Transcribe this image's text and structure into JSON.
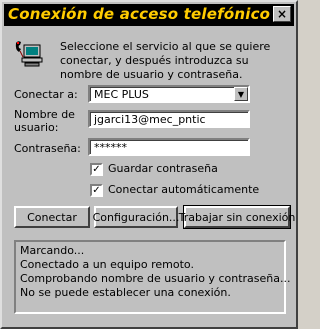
{
  "window": {
    "title": "Conexión de acceso telefónico",
    "close_glyph": "×"
  },
  "intro_text": "Seleccione el servicio al que se quiere conectar, y después introduzca su nombre de usuario y contraseña.",
  "form": {
    "connect_to": {
      "label": "Conectar a:",
      "value": "MEC PLUS",
      "arrow": "▼"
    },
    "username": {
      "label_line1": "Nombre de",
      "label_line2": "usuario:",
      "value": "jgarci13@mec_pntic"
    },
    "password": {
      "label": "Contraseña:",
      "value": "******"
    },
    "save_password": {
      "label": "Guardar contraseña",
      "checked": true,
      "mark": "✓"
    },
    "auto_connect": {
      "label": "Conectar automáticamente",
      "checked": true,
      "mark": "✓"
    }
  },
  "buttons": {
    "connect": "Conectar",
    "settings": "Configuración...",
    "offline": "Trabajar sin conexión"
  },
  "status_log": [
    "Marcando...",
    "Conectado a un equipo remoto.",
    "Comprobando nombre de usuario y contraseña...",
    "No se puede establecer una conexión."
  ],
  "colors": {
    "title_text": "#ffcc00",
    "title_bar": "#000000",
    "face": "#c0c0c0"
  },
  "icons": {
    "dialup": "computer-phone-icon"
  }
}
